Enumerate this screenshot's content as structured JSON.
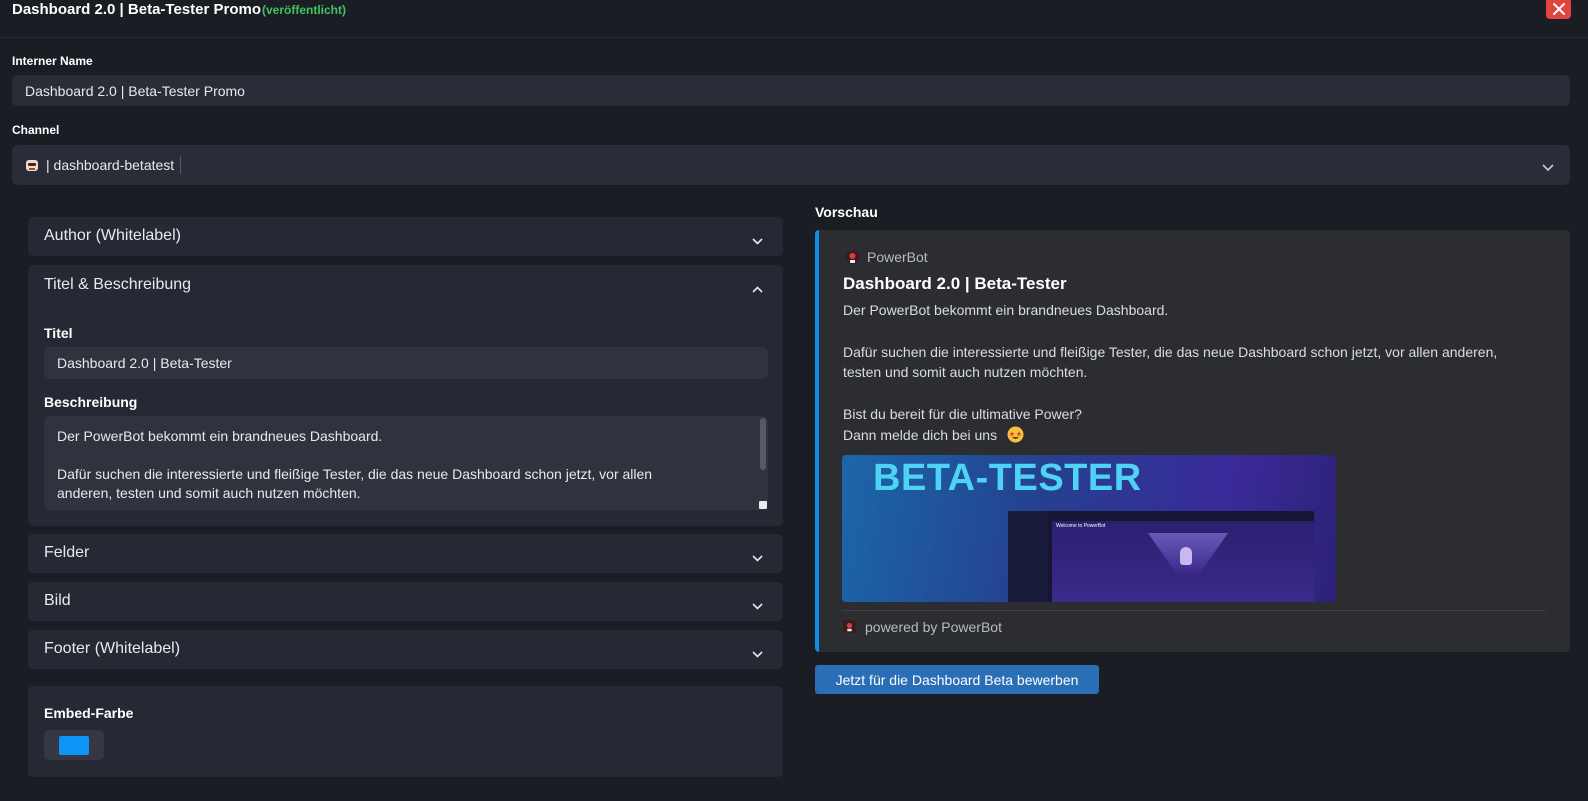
{
  "header": {
    "title": "Dashboard 2.0 | Beta-Tester Promo",
    "status": "(veröffentlicht)"
  },
  "internal_name": {
    "label": "Interner Name",
    "value": "Dashboard 2.0 | Beta-Tester Promo"
  },
  "channel": {
    "label": "Channel",
    "value": "| dashboard-betatest"
  },
  "accordion": {
    "author": "Author (Whitelabel)",
    "title_desc": "Titel & Beschreibung",
    "fields": "Felder",
    "image": "Bild",
    "footer": "Footer (Whitelabel)"
  },
  "title_field": {
    "label": "Titel",
    "value": "Dashboard 2.0 | Beta-Tester"
  },
  "description_field": {
    "label": "Beschreibung",
    "line1": "Der PowerBot bekommt ein brandneues Dashboard.",
    "line2": "Dafür suchen die interessierte und fleißige Tester, die das neue Dashboard schon jetzt, vor allen",
    "line3": "anderen, testen und somit auch nutzen möchten."
  },
  "embed_color": {
    "label": "Embed-Farbe",
    "value": "#0d95f5"
  },
  "preview": {
    "heading": "Vorschau",
    "bot_name": "PowerBot",
    "title": "Dashboard 2.0 | Beta-Tester",
    "line1": "Der PowerBot bekommt ein brandneues Dashboard.",
    "line2": "Dafür suchen die interessierte und fleißige Tester, die das neue Dashboard schon jetzt, vor allen anderen,",
    "line3": "testen und somit auch nutzen möchten.",
    "line4": "Bist du bereit für die ultimative Power?",
    "line5": "Dann melde dich bei uns",
    "image_text": "BETA-TESTER",
    "mock_welcome": "Welcome to PowerBot",
    "footer": "powered by PowerBot"
  },
  "cta_button": "Jetzt für die Dashboard Beta bewerben"
}
